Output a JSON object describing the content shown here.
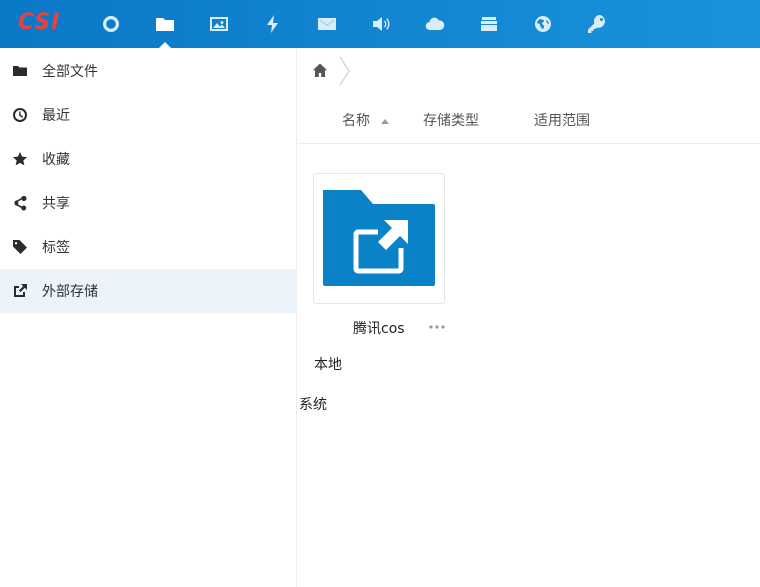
{
  "header": {
    "logo_text": "CSI",
    "apps": [
      {
        "icon": "circle-icon"
      },
      {
        "icon": "folder-icon",
        "active": true
      },
      {
        "icon": "image-icon"
      },
      {
        "icon": "lightning-icon"
      },
      {
        "icon": "mail-icon"
      },
      {
        "icon": "audio-icon"
      },
      {
        "icon": "cloud-icon"
      },
      {
        "icon": "archive-icon"
      },
      {
        "icon": "globe-icon"
      },
      {
        "icon": "key-icon"
      }
    ]
  },
  "sidebar": {
    "items": [
      {
        "label": "全部文件",
        "icon": "folder-icon"
      },
      {
        "label": "最近",
        "icon": "clock-icon"
      },
      {
        "label": "收藏",
        "icon": "star-icon"
      },
      {
        "label": "共享",
        "icon": "share-icon"
      },
      {
        "label": "标签",
        "icon": "tag-icon"
      },
      {
        "label": "外部存储",
        "icon": "external-link-icon",
        "active": true
      }
    ]
  },
  "main": {
    "columns": {
      "name": "名称",
      "storage_type": "存储类型",
      "scope": "适用范围"
    },
    "entry": {
      "name": "腾讯cos",
      "storage_type": "本地",
      "scope": "系统",
      "icon": "external-folder-icon"
    }
  },
  "colors": {
    "header_start": "#0a78c7",
    "header_end": "#1b92dc",
    "logo": "#e8423f",
    "folder": "#0a82c8",
    "active_item_bg": "#ebf3fb"
  }
}
